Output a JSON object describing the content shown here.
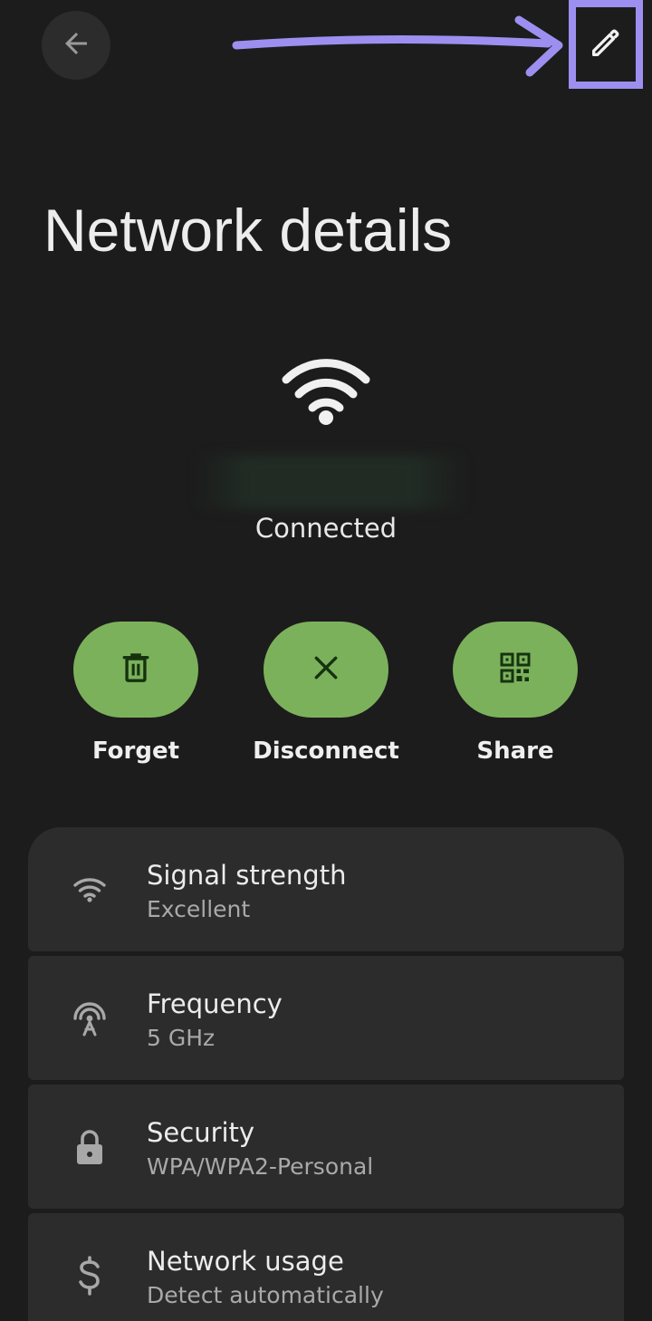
{
  "header": {
    "back_icon": "arrow-left-icon",
    "edit_icon": "pencil-icon",
    "title": "Network details"
  },
  "network": {
    "wifi_icon": "wifi-icon",
    "status": "Connected"
  },
  "actions": [
    {
      "label": "Forget",
      "icon": "trash-icon"
    },
    {
      "label": "Disconnect",
      "icon": "close-icon"
    },
    {
      "label": "Share",
      "icon": "qr-code-icon"
    }
  ],
  "details": [
    {
      "title": "Signal strength",
      "value": "Excellent",
      "icon": "wifi-icon"
    },
    {
      "title": "Frequency",
      "value": "5 GHz",
      "icon": "antenna-icon"
    },
    {
      "title": "Security",
      "value": "WPA/WPA2-Personal",
      "icon": "lock-icon"
    },
    {
      "title": "Network usage",
      "value": "Detect automatically",
      "icon": "dollar-icon"
    }
  ],
  "colors": {
    "background": "#1c1c1c",
    "card": "#2c2c2c",
    "accent_green": "#7cb15c",
    "annotation_purple": "#9d8ff0"
  }
}
